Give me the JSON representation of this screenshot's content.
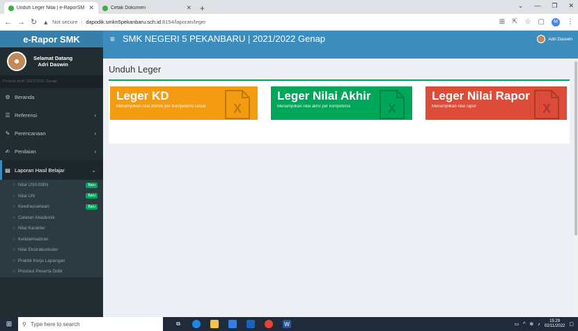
{
  "browser": {
    "tabs": [
      {
        "title": "Unduh Leger Nilai | e-RaporSMK",
        "active": true
      },
      {
        "title": "Cetak Dokumen",
        "active": false
      }
    ],
    "address": {
      "security": "Not secure",
      "host": "dapodik.smkn5pekanbaru.sch.id",
      "path": ":8154/laporan/leger"
    },
    "profile_initial": "M"
  },
  "sidebar": {
    "logo": "e-Rapor SMK",
    "greeting": "Selamat Datang",
    "username": "Adri Daswin",
    "period": "Periode Aktif: 2021/2022 Genap",
    "items": [
      {
        "label": "Beranda",
        "icon": "dashboard-icon"
      },
      {
        "label": "Referensi",
        "icon": "list-icon"
      },
      {
        "label": "Perencanaan",
        "icon": "edit-icon"
      },
      {
        "label": "Penilaian",
        "icon": "pencil-icon"
      },
      {
        "label": "Laporan Hasil Belajar",
        "icon": "report-icon"
      }
    ],
    "subitems": [
      {
        "label": "Nilai US/USBN",
        "badge": "Baru"
      },
      {
        "label": "Nilai UN",
        "badge": "Baru"
      },
      {
        "label": "Kewirausahaan",
        "badge": "Baru"
      },
      {
        "label": "Catatan Akademik",
        "badge": ""
      },
      {
        "label": "Nilai Karakter",
        "badge": ""
      },
      {
        "label": "Ketidakhadiran",
        "badge": ""
      },
      {
        "label": "Nilai Ekstrakurikuler",
        "badge": ""
      },
      {
        "label": "Praktik Kerja Lapangan",
        "badge": ""
      },
      {
        "label": "Prestasi Peserta Didik",
        "badge": ""
      }
    ]
  },
  "header": {
    "school": "SMK NEGERI 5 PEKANBARU | 2021/2022 Genap",
    "user": "Adri Daswin"
  },
  "main": {
    "title": "Unduh Leger",
    "cards": [
      {
        "title": "Leger KD",
        "desc": "Menampilkan nilai otentik per Kompetensi Dasar",
        "color": "#f39c12"
      },
      {
        "title": "Leger Nilai Akhir",
        "desc": "Menampilkan nilai akhir per kompetensi",
        "color": "#00a65a"
      },
      {
        "title": "Leger Nilai Rapor",
        "desc": "Menampilkan nilai rapor",
        "color": "#dd4b39"
      }
    ]
  },
  "taskbar": {
    "search_placeholder": "Type here to search",
    "time": "15:29",
    "date": "02/11/2022"
  }
}
